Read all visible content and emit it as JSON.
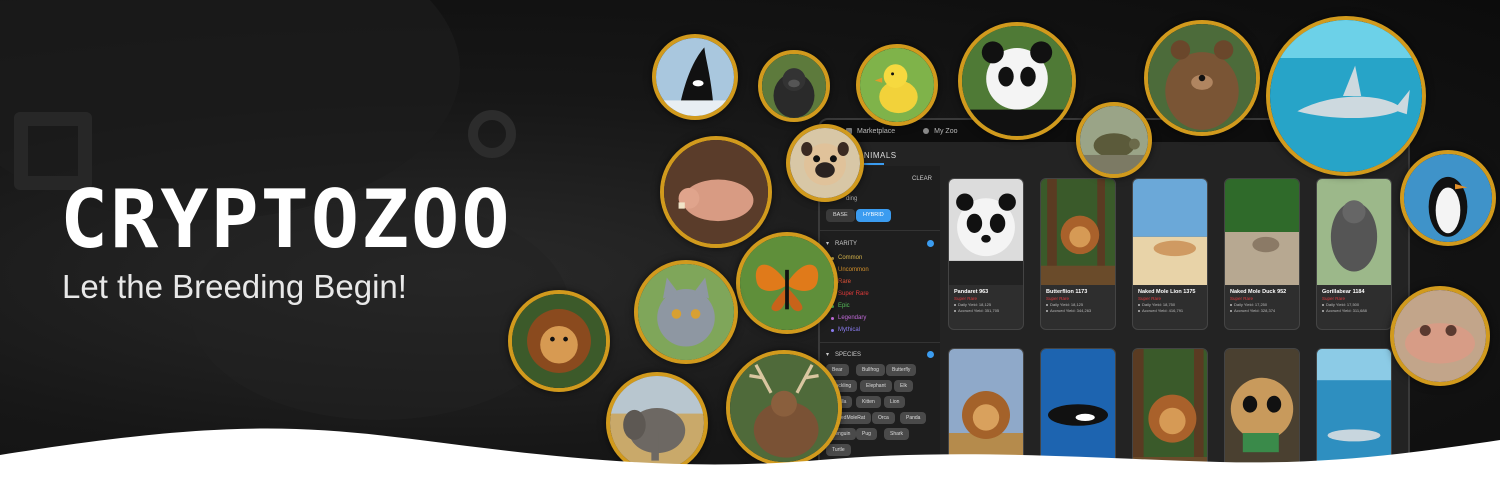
{
  "brand": {
    "title": "CRYPTOZOO",
    "tagline": "Let the Breeding Begin!"
  },
  "app": {
    "nav": [
      {
        "label": "Marketplace",
        "icon": "store-icon"
      },
      {
        "label": "My Zoo",
        "icon": "globe-icon"
      }
    ],
    "section_title": "ANIMALS",
    "sidebar": {
      "clear_label": "CLEAR",
      "filter_label": "ding",
      "type_pills": [
        {
          "label": "BASE",
          "active": false
        },
        {
          "label": "HYBRID",
          "active": true
        }
      ],
      "rarity": {
        "label": "RARITY",
        "items": [
          {
            "label": "Common",
            "color": "#d4b24a"
          },
          {
            "label": "Uncommon",
            "color": "#d4902a"
          },
          {
            "label": "Rare",
            "color": "#e2543a"
          },
          {
            "label": "Super Rare",
            "color": "#e23a3a"
          },
          {
            "label": "Epic",
            "color": "#56c15a"
          },
          {
            "label": "Legendary",
            "color": "#c06ad8"
          },
          {
            "label": "Mythical",
            "color": "#8a7cf0"
          }
        ]
      },
      "species": {
        "label": "SPECIES",
        "chips": [
          "Bear",
          "Bullfrog",
          "Butterfly",
          "Duckling",
          "Elephant",
          "Elk",
          "Gorilla",
          "Kitten",
          "Lion",
          "NakedMoleRat",
          "Orca",
          "Panda",
          "Penguin",
          "Pug",
          "Shark",
          "Turtle"
        ]
      }
    },
    "cards": [
      {
        "name": "Pandaret 963",
        "rarity": "Super Rare",
        "yield": "Daily Yield: 18,125",
        "accrued": "Accrued Yield: 351,705",
        "scene": "panda"
      },
      {
        "name": "Butterflion 1173",
        "rarity": "Super Rare",
        "yield": "Daily Yield: 18,125",
        "accrued": "Accrued Yield: 344,263",
        "scene": "lion-forest"
      },
      {
        "name": "Naked Mole Lion 1375",
        "rarity": "Super Rare",
        "yield": "Daily Yield: 18,750",
        "accrued": "Accrued Yield: 416,791",
        "scene": "beach"
      },
      {
        "name": "Naked Mole Duck 952",
        "rarity": "Super Rare",
        "yield": "Daily Yield: 17,250",
        "accrued": "Accrued Yield: 328,374",
        "scene": "grass"
      },
      {
        "name": "Gorillabear 1184",
        "rarity": "Super Rare",
        "yield": "Daily Yield: 17,500",
        "accrued": "Accrued Yield: 311,688",
        "scene": "gorilla"
      }
    ],
    "cards_row2": [
      {
        "scene": "lion-field"
      },
      {
        "scene": "orca"
      },
      {
        "scene": "lion-forest"
      },
      {
        "scene": "panda-lion"
      },
      {
        "scene": "shark"
      }
    ]
  },
  "bubbles": [
    {
      "name": "orca-bubble",
      "animal": "orca"
    },
    {
      "name": "gorilla-bubble",
      "animal": "gorilla"
    },
    {
      "name": "duckling-bubble",
      "animal": "duckling"
    },
    {
      "name": "panda-bubble",
      "animal": "panda"
    },
    {
      "name": "bear-bubble",
      "animal": "bear"
    },
    {
      "name": "shark-bubble",
      "animal": "shark"
    },
    {
      "name": "pug-bubble",
      "animal": "pug"
    },
    {
      "name": "turtle-bubble",
      "animal": "turtle"
    },
    {
      "name": "mole-rat-bubble",
      "animal": "naked-mole-rat"
    },
    {
      "name": "butterfly-bubble",
      "animal": "butterfly"
    },
    {
      "name": "kitten-bubble",
      "animal": "kitten"
    },
    {
      "name": "lion-bubble",
      "animal": "lion"
    },
    {
      "name": "elephant-bubble",
      "animal": "elephant"
    },
    {
      "name": "elk-bubble",
      "animal": "elk"
    },
    {
      "name": "penguin-bubble",
      "animal": "penguin"
    },
    {
      "name": "bullfrog-bubble",
      "animal": "bullfrog"
    }
  ],
  "colors": {
    "accent": "#3b9cf0",
    "bubble_border": "#d19a1d",
    "rarity_red": "#e0393e"
  }
}
